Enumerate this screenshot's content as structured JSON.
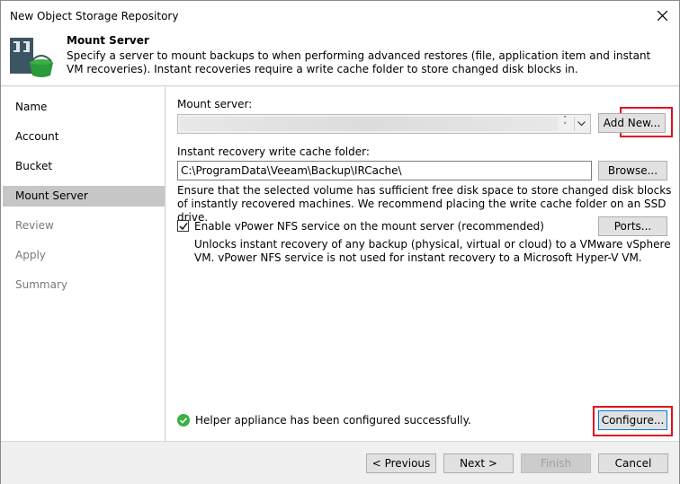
{
  "window": {
    "title": "New Object Storage Repository"
  },
  "header": {
    "title": "Mount Server",
    "description": "Specify a server to mount backups to when performing advanced restores (file, application item and instant VM recoveries). Instant recoveries require a write cache folder to store changed disk blocks in.",
    "icon": "storage-repository-icon"
  },
  "sidebar": {
    "steps": [
      {
        "label": "Name",
        "state": "done"
      },
      {
        "label": "Account",
        "state": "done"
      },
      {
        "label": "Bucket",
        "state": "done"
      },
      {
        "label": "Mount Server",
        "state": "active"
      },
      {
        "label": "Review",
        "state": "pending"
      },
      {
        "label": "Apply",
        "state": "pending"
      },
      {
        "label": "Summary",
        "state": "pending"
      }
    ]
  },
  "content": {
    "mount_server_label": "Mount server:",
    "add_new_label": "Add New...",
    "cache_folder_label": "Instant recovery write cache folder:",
    "cache_folder_value": "C:\\ProgramData\\Veeam\\Backup\\IRCache\\",
    "browse_label": "Browse...",
    "disk_space_note": "Ensure that the selected volume has sufficient free disk space to store changed disk blocks of instantly recovered machines. We recommend placing the write cache folder on an SSD drive.",
    "vpower_checkbox_label": "Enable vPower NFS service on the mount server (recommended)",
    "vpower_checked": true,
    "ports_label": "Ports...",
    "vpower_note": "Unlocks instant recovery of any backup (physical, virtual or cloud) to a VMware vSphere VM. vPower NFS service is not used for instant recovery to a Microsoft Hyper-V VM.",
    "status_text": "Helper appliance has been configured successfully.",
    "status_icon": "check-circle-icon",
    "status_color": "#3cb043",
    "configure_label": "Configure..."
  },
  "footer": {
    "previous_label": "< Previous",
    "next_label": "Next >",
    "finish_label": "Finish",
    "cancel_label": "Cancel"
  },
  "highlight_color": "#e3101e"
}
